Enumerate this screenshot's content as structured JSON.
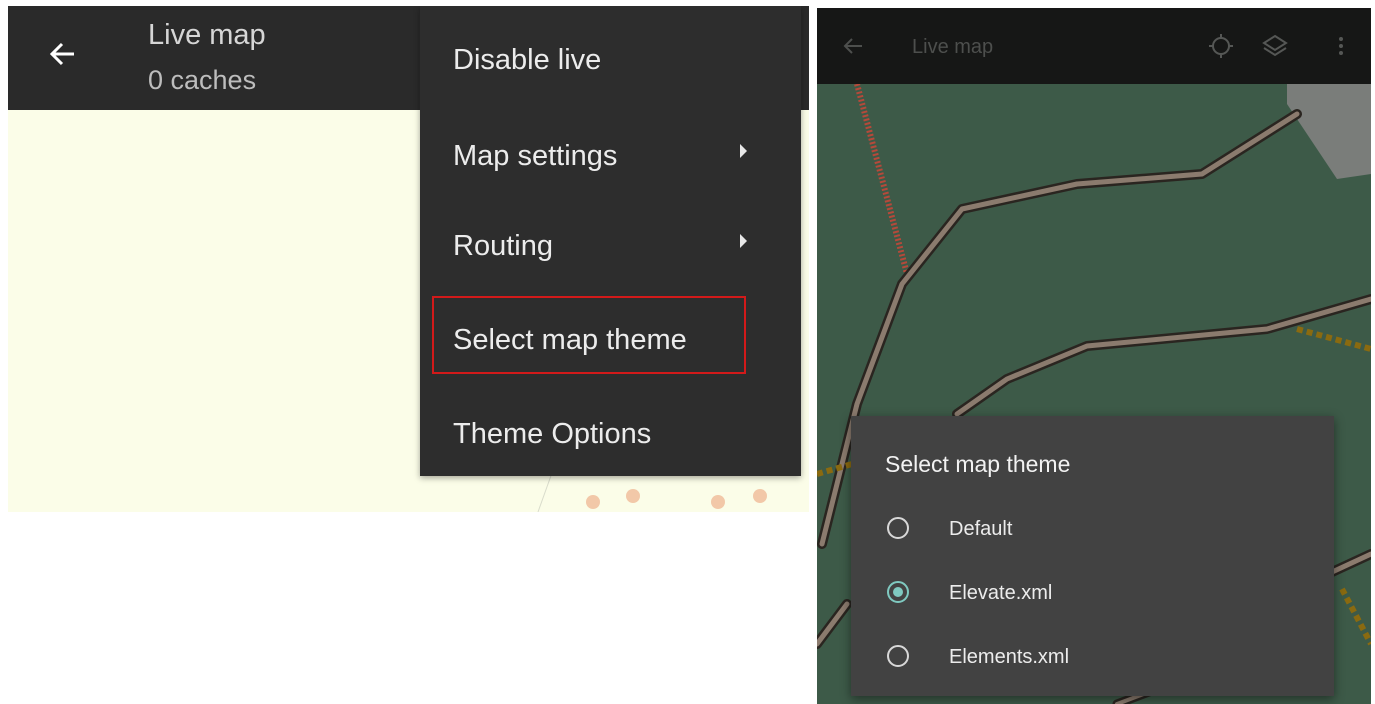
{
  "left_screen": {
    "app_bar": {
      "title": "Live map",
      "subtitle": "0 caches",
      "back_icon": "arrow-left-icon"
    },
    "overflow_menu": {
      "items": [
        {
          "label": "Disable live",
          "has_submenu": false
        },
        {
          "label": "Map settings",
          "has_submenu": true
        },
        {
          "label": "Routing",
          "has_submenu": true
        },
        {
          "label": "Select map theme",
          "has_submenu": false,
          "highlighted": true
        },
        {
          "label": "Theme Options",
          "has_submenu": false
        }
      ]
    }
  },
  "right_screen": {
    "app_bar": {
      "title": "Live map",
      "back_icon": "arrow-left-icon",
      "actions": [
        "my-location-icon",
        "layers-icon",
        "more-vert-icon"
      ]
    },
    "dialog": {
      "title": "Select map theme",
      "options": [
        {
          "label": "Default",
          "selected": false
        },
        {
          "label": "Elevate.xml",
          "selected": true
        },
        {
          "label": "Elements.xml",
          "selected": false
        }
      ]
    }
  },
  "colors": {
    "app_bar": "#2a2a2a",
    "menu_background": "#2d2d2d",
    "highlight_border": "#d21a1a",
    "map_light": "#fbfde8",
    "map_dark": "#3d5a48",
    "dialog_background": "#424242",
    "radio_accent": "#7fc9c0"
  }
}
